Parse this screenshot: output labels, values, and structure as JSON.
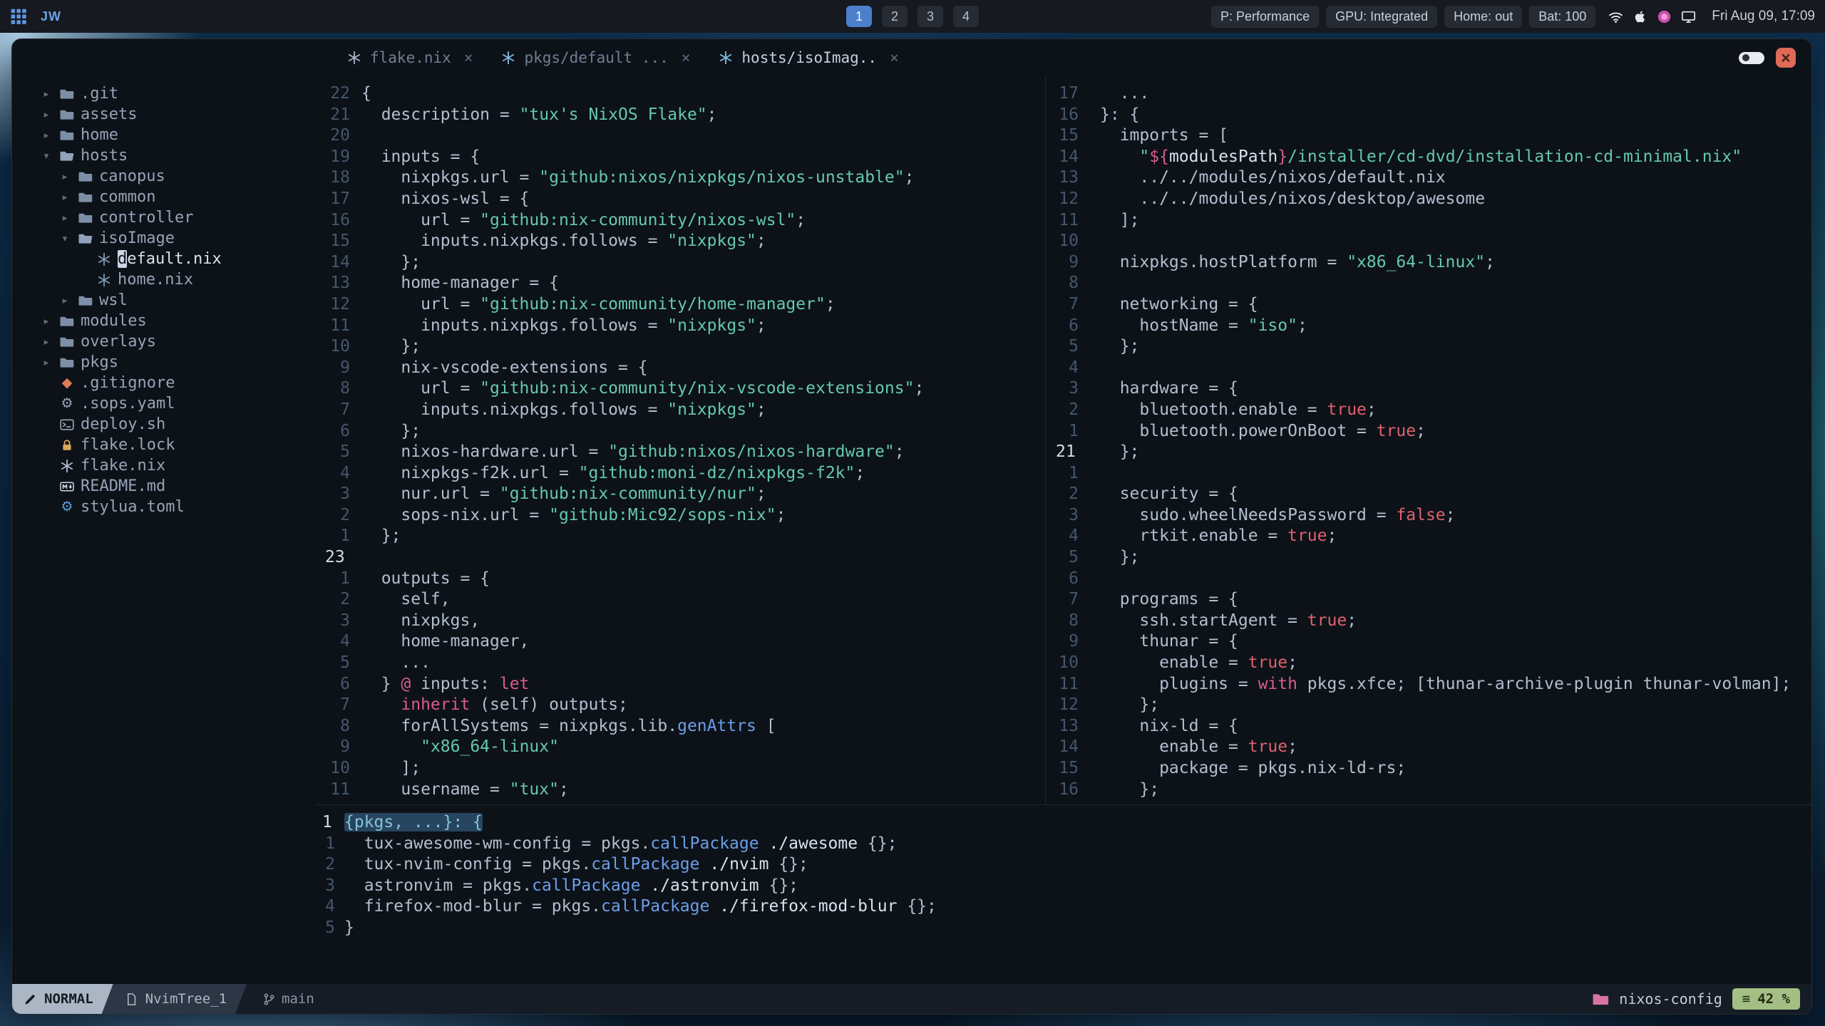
{
  "topbar": {
    "launcher": "JW",
    "workspaces": {
      "items": [
        "1",
        "2",
        "3",
        "4"
      ],
      "active": "1"
    },
    "stats": [
      {
        "label": "P: Performance"
      },
      {
        "label": "GPU: Integrated"
      },
      {
        "label": "Home: out"
      },
      {
        "label": "Bat: 100"
      }
    ],
    "tray_icons": [
      "wifi-icon",
      "apple-icon",
      "color-picker-icon",
      "display-icon"
    ],
    "clock": "Fri Aug 09, 17:09"
  },
  "window": {
    "tab_close": "×",
    "close_glyph": "×",
    "tabs": [
      {
        "label": "flake.nix",
        "icon": "nix",
        "icon_color": "#a9b4c4",
        "active": false
      },
      {
        "label": "pkgs/default ...",
        "icon": "nix",
        "icon_color": "#7ebae4",
        "active": false
      },
      {
        "label": "hosts/isoImag..",
        "icon": "nix",
        "icon_color": "#7ebae4",
        "active": true
      }
    ]
  },
  "tree": {
    "items": [
      {
        "label": ".git",
        "icon": "folder",
        "chevron": "collapsed",
        "depth": 0
      },
      {
        "label": "assets",
        "icon": "folder",
        "chevron": "collapsed",
        "depth": 0
      },
      {
        "label": "home",
        "icon": "folder",
        "chevron": "collapsed",
        "depth": 0
      },
      {
        "label": "hosts",
        "icon": "folder-open",
        "chevron": "expanded",
        "depth": 0
      },
      {
        "label": "canopus",
        "icon": "folder",
        "chevron": "collapsed",
        "depth": 1
      },
      {
        "label": "common",
        "icon": "folder",
        "chevron": "collapsed",
        "depth": 1
      },
      {
        "label": "controller",
        "icon": "folder",
        "chevron": "collapsed",
        "depth": 1
      },
      {
        "label": "isoImage",
        "icon": "folder-open",
        "chevron": "expanded",
        "depth": 1
      },
      {
        "label": "default.nix",
        "icon": "nix",
        "depth": 2,
        "cursor": true
      },
      {
        "label": "home.nix",
        "icon": "nix",
        "depth": 2
      },
      {
        "label": "wsl",
        "icon": "folder",
        "chevron": "collapsed",
        "depth": 1
      },
      {
        "label": "modules",
        "icon": "folder",
        "chevron": "collapsed",
        "depth": 0
      },
      {
        "label": "overlays",
        "icon": "folder",
        "chevron": "collapsed",
        "depth": 0
      },
      {
        "label": "pkgs",
        "icon": "folder",
        "chevron": "collapsed",
        "depth": 0
      },
      {
        "label": ".gitignore",
        "icon": "git",
        "depth": 0
      },
      {
        "label": ".sops.yaml",
        "icon": "gear-gray",
        "depth": 0
      },
      {
        "label": "deploy.sh",
        "icon": "terminal",
        "depth": 0
      },
      {
        "label": "flake.lock",
        "icon": "lock",
        "depth": 0
      },
      {
        "label": "flake.nix",
        "icon": "nix-light",
        "depth": 0
      },
      {
        "label": "README.md",
        "icon": "markdown",
        "depth": 0
      },
      {
        "label": "stylua.toml",
        "icon": "gear-blue",
        "depth": 0
      }
    ]
  },
  "editors": {
    "left": {
      "lines": [
        {
          "n": "22",
          "t": [
            [
              "{"
            ]
          ]
        },
        {
          "n": "21",
          "t": [
            [
              "  description = "
            ],
            [
              "\"tux's NixOS Flake\"",
              "str"
            ],
            [
              ";"
            ]
          ]
        },
        {
          "n": "20",
          "t": []
        },
        {
          "n": "19",
          "t": [
            [
              "  inputs = {"
            ]
          ]
        },
        {
          "n": "18",
          "t": [
            [
              "    nixpkgs.url = "
            ],
            [
              "\"github:nixos/nixpkgs/nixos-unstable\"",
              "str"
            ],
            [
              ";"
            ]
          ]
        },
        {
          "n": "17",
          "t": [
            [
              "    nixos-wsl = {"
            ]
          ]
        },
        {
          "n": "16",
          "t": [
            [
              "      url = "
            ],
            [
              "\"github:nix-community/nixos-wsl\"",
              "str"
            ],
            [
              ";"
            ]
          ]
        },
        {
          "n": "15",
          "t": [
            [
              "      inputs.nixpkgs.follows = "
            ],
            [
              "\"nixpkgs\"",
              "str"
            ],
            [
              ";"
            ]
          ]
        },
        {
          "n": "14",
          "t": [
            [
              "    };"
            ]
          ]
        },
        {
          "n": "13",
          "t": [
            [
              "    home-manager = {"
            ]
          ]
        },
        {
          "n": "12",
          "t": [
            [
              "      url = "
            ],
            [
              "\"github:nix-community/home-manager\"",
              "str"
            ],
            [
              ";"
            ]
          ]
        },
        {
          "n": "11",
          "t": [
            [
              "      inputs.nixpkgs.follows = "
            ],
            [
              "\"nixpkgs\"",
              "str"
            ],
            [
              ";"
            ]
          ]
        },
        {
          "n": "10",
          "t": [
            [
              "    };"
            ]
          ]
        },
        {
          "n": "9",
          "t": [
            [
              "    nix-vscode-extensions = {"
            ]
          ]
        },
        {
          "n": "8",
          "t": [
            [
              "      url = "
            ],
            [
              "\"github:nix-community/nix-vscode-extensions\"",
              "str"
            ],
            [
              ";"
            ]
          ]
        },
        {
          "n": "7",
          "t": [
            [
              "      inputs.nixpkgs.follows = "
            ],
            [
              "\"nixpkgs\"",
              "str"
            ],
            [
              ";"
            ]
          ]
        },
        {
          "n": "6",
          "t": [
            [
              "    };"
            ]
          ]
        },
        {
          "n": "5",
          "t": [
            [
              "    nixos-hardware.url = "
            ],
            [
              "\"github:nixos/nixos-hardware\"",
              "str"
            ],
            [
              ";"
            ]
          ]
        },
        {
          "n": "4",
          "t": [
            [
              "    nixpkgs-f2k.url = "
            ],
            [
              "\"github:moni-dz/nixpkgs-f2k\"",
              "str"
            ],
            [
              ";"
            ]
          ]
        },
        {
          "n": "3",
          "t": [
            [
              "    nur.url = "
            ],
            [
              "\"github:nix-community/nur\"",
              "str"
            ],
            [
              ";"
            ]
          ]
        },
        {
          "n": "2",
          "t": [
            [
              "    sops-nix.url = "
            ],
            [
              "\"github:Mic92/sops-nix\"",
              "str"
            ],
            [
              ";"
            ]
          ]
        },
        {
          "n": "1",
          "t": [
            [
              "  };"
            ]
          ]
        },
        {
          "n": "23",
          "c": true,
          "t": []
        },
        {
          "n": "1",
          "t": [
            [
              "  outputs = {"
            ]
          ]
        },
        {
          "n": "2",
          "t": [
            [
              "    self,"
            ]
          ]
        },
        {
          "n": "3",
          "t": [
            [
              "    nixpkgs,"
            ]
          ]
        },
        {
          "n": "4",
          "t": [
            [
              "    home-manager,"
            ]
          ]
        },
        {
          "n": "5",
          "t": [
            [
              "    ..."
            ]
          ]
        },
        {
          "n": "6",
          "t": [
            [
              "  } "
            ],
            [
              "@",
              "kw"
            ],
            [
              " inputs: "
            ],
            [
              "let",
              "kw"
            ]
          ]
        },
        {
          "n": "7",
          "t": [
            [
              "    "
            ],
            [
              "inherit",
              "kw"
            ],
            [
              " (self) outputs;"
            ]
          ]
        },
        {
          "n": "8",
          "t": [
            [
              "    forAllSystems = nixpkgs.lib."
            ],
            [
              "genAttrs",
              "fn"
            ],
            [
              " ["
            ]
          ]
        },
        {
          "n": "9",
          "t": [
            [
              "      "
            ],
            [
              "\"x86_64-linux\"",
              "str"
            ]
          ]
        },
        {
          "n": "10",
          "t": [
            [
              "    ];"
            ]
          ]
        },
        {
          "n": "11",
          "t": [
            [
              "    username = "
            ],
            [
              "\"tux\"",
              "str"
            ],
            [
              ";"
            ]
          ]
        }
      ]
    },
    "right": {
      "lines": [
        {
          "n": "17",
          "t": [
            [
              "  ..."
            ]
          ]
        },
        {
          "n": "16",
          "t": [
            [
              "}: {"
            ]
          ]
        },
        {
          "n": "15",
          "t": [
            [
              "  imports = ["
            ]
          ]
        },
        {
          "n": "14",
          "t": [
            [
              "    "
            ],
            [
              "\"",
              "str"
            ],
            [
              "${",
              "kw"
            ],
            [
              "modulesPath",
              "brt"
            ],
            [
              "}",
              "kw"
            ],
            [
              "/installer/cd-dvd/installation-cd-minimal.nix\"",
              "str"
            ]
          ]
        },
        {
          "n": "13",
          "t": [
            [
              "    ../../modules/nixos/default.nix"
            ]
          ]
        },
        {
          "n": "12",
          "t": [
            [
              "    ../../modules/nixos/desktop/awesome"
            ]
          ]
        },
        {
          "n": "11",
          "t": [
            [
              "  ];"
            ]
          ]
        },
        {
          "n": "10",
          "t": []
        },
        {
          "n": "9",
          "t": [
            [
              "  nixpkgs.hostPlatform = "
            ],
            [
              "\"x86_64-linux\"",
              "str"
            ],
            [
              ";"
            ]
          ]
        },
        {
          "n": "8",
          "t": []
        },
        {
          "n": "7",
          "t": [
            [
              "  networking = {"
            ]
          ]
        },
        {
          "n": "6",
          "t": [
            [
              "    hostName = "
            ],
            [
              "\"iso\"",
              "str"
            ],
            [
              ";"
            ]
          ]
        },
        {
          "n": "5",
          "t": [
            [
              "  };"
            ]
          ]
        },
        {
          "n": "4",
          "t": []
        },
        {
          "n": "3",
          "t": [
            [
              "  hardware = {"
            ]
          ]
        },
        {
          "n": "2",
          "t": [
            [
              "    bluetooth.enable = "
            ],
            [
              "true",
              "bool"
            ],
            [
              ";"
            ]
          ]
        },
        {
          "n": "1",
          "t": [
            [
              "    bluetooth.powerOnBoot = "
            ],
            [
              "true",
              "bool"
            ],
            [
              ";"
            ]
          ]
        },
        {
          "n": "21",
          "c": true,
          "t": [
            [
              "  };"
            ]
          ]
        },
        {
          "n": "1",
          "t": []
        },
        {
          "n": "2",
          "t": [
            [
              "  security = {"
            ]
          ]
        },
        {
          "n": "3",
          "t": [
            [
              "    sudo.wheelNeedsPassword = "
            ],
            [
              "false",
              "bool"
            ],
            [
              ";"
            ]
          ]
        },
        {
          "n": "4",
          "t": [
            [
              "    rtkit.enable = "
            ],
            [
              "true",
              "bool"
            ],
            [
              ";"
            ]
          ]
        },
        {
          "n": "5",
          "t": [
            [
              "  };"
            ]
          ]
        },
        {
          "n": "6",
          "t": []
        },
        {
          "n": "7",
          "t": [
            [
              "  programs = {"
            ]
          ]
        },
        {
          "n": "8",
          "t": [
            [
              "    ssh.startAgent = "
            ],
            [
              "true",
              "bool"
            ],
            [
              ";"
            ]
          ]
        },
        {
          "n": "9",
          "t": [
            [
              "    thunar = {"
            ]
          ]
        },
        {
          "n": "10",
          "t": [
            [
              "      enable = "
            ],
            [
              "true",
              "bool"
            ],
            [
              ";"
            ]
          ]
        },
        {
          "n": "11",
          "t": [
            [
              "      plugins = "
            ],
            [
              "with",
              "kw"
            ],
            [
              " pkgs.xfce; [thunar-archive-plugin thunar-volman];"
            ]
          ]
        },
        {
          "n": "12",
          "t": [
            [
              "    };"
            ]
          ]
        },
        {
          "n": "13",
          "t": [
            [
              "    nix-ld = {"
            ]
          ]
        },
        {
          "n": "14",
          "t": [
            [
              "      enable = "
            ],
            [
              "true",
              "bool"
            ],
            [
              ";"
            ]
          ]
        },
        {
          "n": "15",
          "t": [
            [
              "      package = pkgs.nix-ld-rs;"
            ]
          ]
        },
        {
          "n": "16",
          "t": [
            [
              "    };"
            ]
          ]
        }
      ]
    },
    "bottom": {
      "lines": [
        {
          "n": "1",
          "c": true,
          "t": [
            [
              "{pkgs, ...}: {",
              "sel"
            ]
          ]
        },
        {
          "n": "1",
          "t": [
            [
              "  tux-awesome-wm-config = pkgs."
            ],
            [
              "callPackage",
              "fn"
            ],
            [
              " "
            ],
            [
              "./awesome",
              "brt"
            ],
            [
              " {};"
            ]
          ]
        },
        {
          "n": "2",
          "t": [
            [
              "  tux-nvim-config = pkgs."
            ],
            [
              "callPackage",
              "fn"
            ],
            [
              " "
            ],
            [
              "./nvim",
              "brt"
            ],
            [
              " {};"
            ]
          ]
        },
        {
          "n": "3",
          "t": [
            [
              "  astronvim = pkgs."
            ],
            [
              "callPackage",
              "fn"
            ],
            [
              " "
            ],
            [
              "./astronvim",
              "brt"
            ],
            [
              " {};"
            ]
          ]
        },
        {
          "n": "4",
          "t": [
            [
              "  firefox-mod-blur = pkgs."
            ],
            [
              "callPackage",
              "fn"
            ],
            [
              " "
            ],
            [
              "./firefox-mod-blur",
              "brt"
            ],
            [
              " {};"
            ]
          ]
        },
        {
          "n": "5",
          "t": [
            [
              "}"
            ]
          ]
        }
      ]
    }
  },
  "statusline": {
    "mode": "NORMAL",
    "buffer": "NvimTree_1",
    "branch": "main",
    "project": "nixos-config",
    "scroll": "42 %"
  }
}
